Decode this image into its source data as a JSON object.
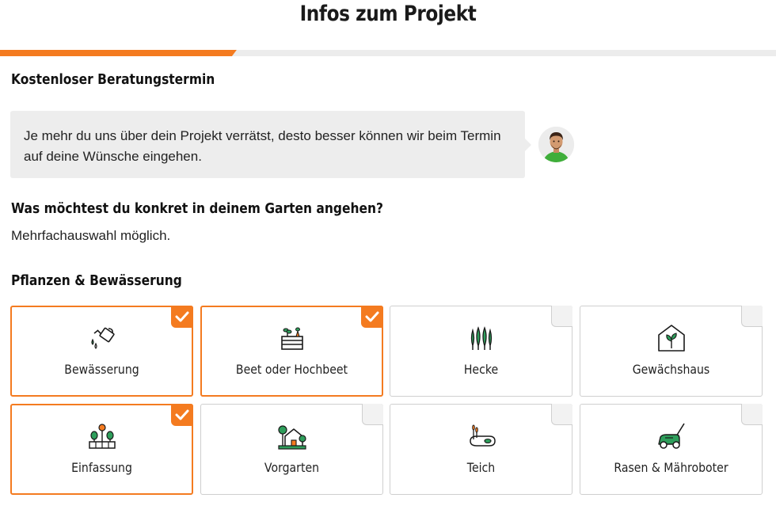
{
  "page": {
    "title": "Infos zum Projekt",
    "progress_fraction": 0.305
  },
  "consultation": {
    "heading": "Kostenloser Beratungstermin",
    "message": "Je mehr du uns über dein Projekt verrätst, desto besser können wir beim Termin auf deine Wünsche eingehen."
  },
  "question": {
    "heading": "Was möchtest du konkret in deinem Garten angehen?",
    "hint": "Mehrfachauswahl möglich."
  },
  "section": {
    "heading": "Pflanzen & Bewässerung",
    "options": [
      {
        "label": "Bewässerung",
        "icon": "watering-can-icon",
        "selected": true
      },
      {
        "label": "Beet oder Hochbeet",
        "icon": "raised-bed-icon",
        "selected": true
      },
      {
        "label": "Hecke",
        "icon": "hedge-icon",
        "selected": false
      },
      {
        "label": "Gewächshaus",
        "icon": "greenhouse-icon",
        "selected": false
      },
      {
        "label": "Einfassung",
        "icon": "border-fence-icon",
        "selected": true
      },
      {
        "label": "Vorgarten",
        "icon": "front-yard-icon",
        "selected": false
      },
      {
        "label": "Teich",
        "icon": "pond-icon",
        "selected": false
      },
      {
        "label": "Rasen & Mähroboter",
        "icon": "lawn-mower-icon",
        "selected": false
      }
    ]
  },
  "colors": {
    "accent": "#f47b20",
    "icon_green": "#2e9e5b",
    "bubble_bg": "#ededed"
  }
}
